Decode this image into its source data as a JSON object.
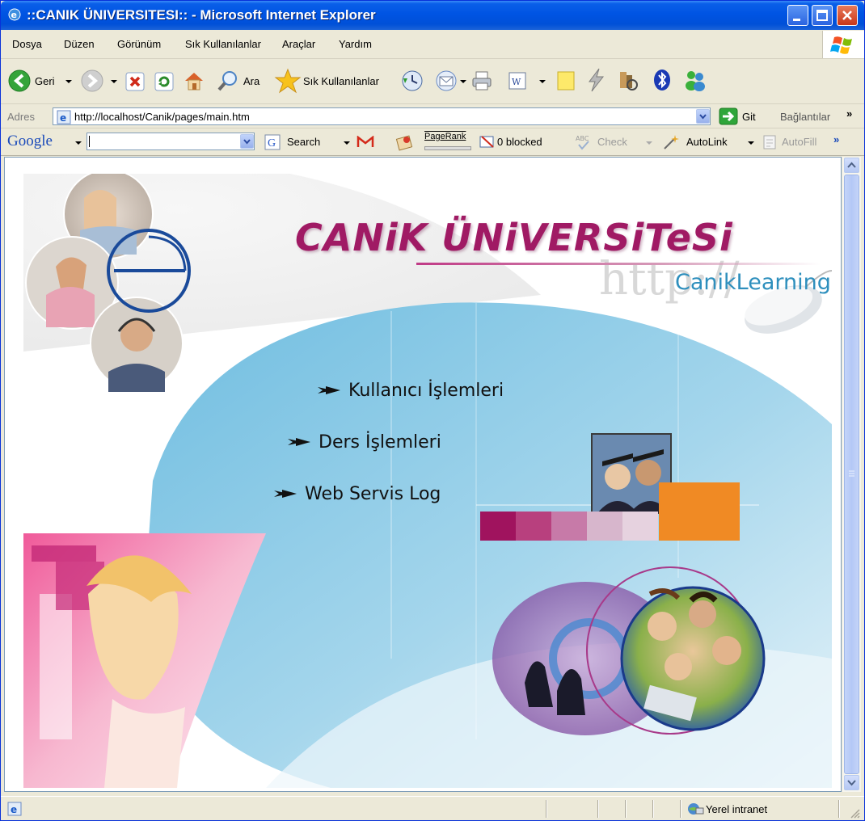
{
  "window": {
    "title": "::CANIK ÜNIVERSITESI:: - Microsoft Internet Explorer"
  },
  "menubar": {
    "items": [
      "Dosya",
      "Düzen",
      "Görünüm",
      "Sık Kullanılanlar",
      "Araçlar",
      "Yardım"
    ]
  },
  "toolbar": {
    "back_label": "Geri",
    "search_label": "Ara",
    "favorites_label": "Sık Kullanılanlar"
  },
  "address": {
    "label": "Adres",
    "url": "http://localhost/Canik/pages/main.htm",
    "go_label": "Git",
    "links_label": "Bağlantılar",
    "chevron": "»"
  },
  "googlebar": {
    "logo": "Google",
    "search_label": "Search",
    "pagerank_label": "PageRank",
    "blocked_label": "0 blocked",
    "check_label": "Check",
    "autolink_label": "AutoLink",
    "autofill_label": "AutoFill",
    "chevron": "»"
  },
  "page": {
    "brand_title": "CANiK ÜNiVERSiTeSi",
    "watermark": "http://",
    "subtitle": "CanikLearning",
    "links": [
      {
        "label": "Kullanıcı İşlemleri"
      },
      {
        "label": "Ders İşlemleri"
      },
      {
        "label": "Web Servis Log"
      }
    ],
    "color_strip": [
      "#a0135e",
      "#b8407e",
      "#c77aa8",
      "#d7b6cc",
      "#e6d2df"
    ],
    "accent_orange": "#f08a24",
    "accent_blue": "#5fb0d6"
  },
  "statusbar": {
    "zone": "Yerel intranet"
  },
  "colors": {
    "titlebar": "#0054e3",
    "chrome": "#ece9d8",
    "brand": "#a01a64",
    "learning": "#2e8fbd"
  }
}
